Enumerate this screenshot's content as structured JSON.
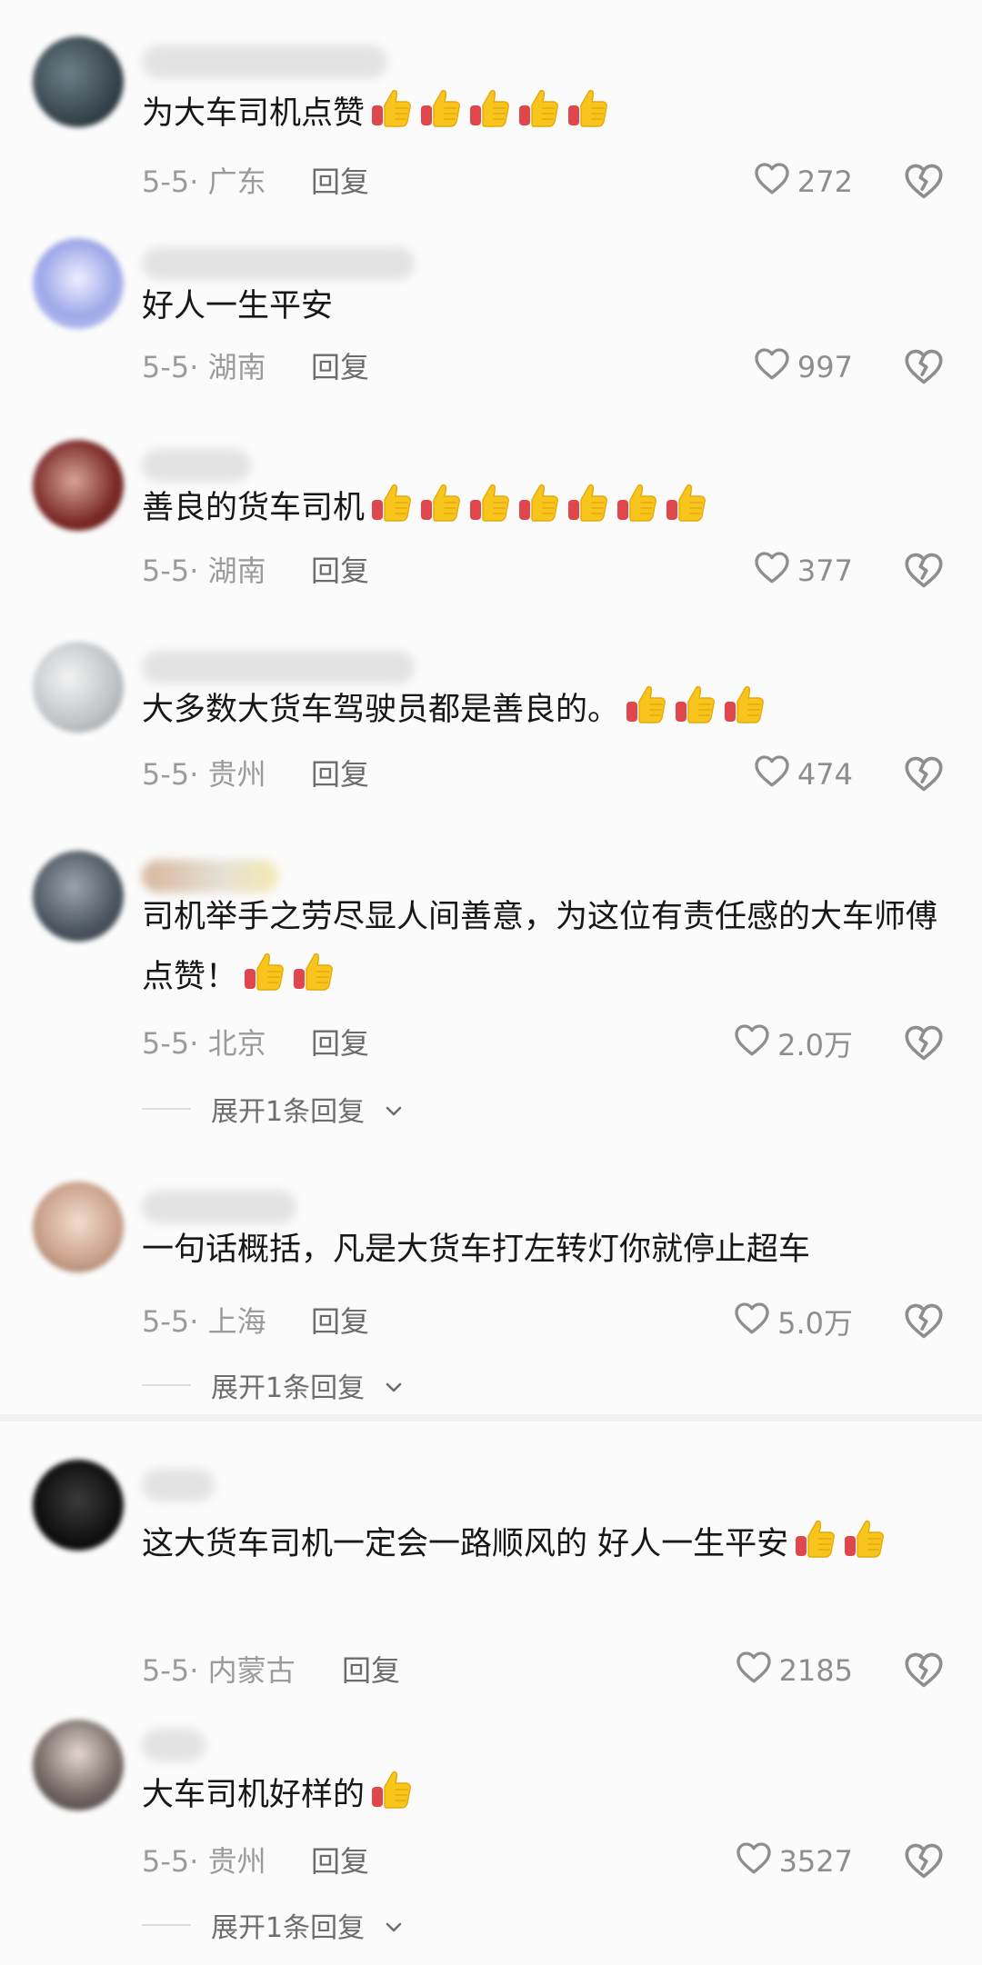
{
  "colors": {
    "text": "#171717",
    "meta": "#9b9b9b",
    "reply": "#6c6c6c",
    "icon": "#8e8e8e",
    "background": "#fbfbfb"
  },
  "icons": {
    "like": "heart-outline-icon",
    "dislike": "broken-heart-icon",
    "emoji": "thumbs-up-emoji",
    "expand": "chevron-down-icon"
  },
  "reply_label": "回复",
  "comments": [
    {
      "text": "为大车司机点赞",
      "emoji_count": 5,
      "date": "5-5",
      "location": "广东",
      "likes": "272",
      "replies": ""
    },
    {
      "text": "好人一生平安",
      "emoji_count": 0,
      "date": "5-5",
      "location": "湖南",
      "likes": "997",
      "replies": ""
    },
    {
      "text": "善良的货车司机",
      "emoji_count": 7,
      "date": "5-5",
      "location": "湖南",
      "likes": "377",
      "replies": ""
    },
    {
      "text": "大多数大货车驾驶员都是善良的。",
      "emoji_count": 3,
      "date": "5-5",
      "location": "贵州",
      "likes": "474",
      "replies": ""
    },
    {
      "text": "司机举手之劳尽显人间善意，为这位有责任感的大车师傅点赞！",
      "emoji_count": 2,
      "date": "5-5",
      "location": "北京",
      "likes": "2.0万",
      "replies": "展开1条回复"
    },
    {
      "text": "一句话概括，凡是大货车打左转灯你就停止超车",
      "emoji_count": 0,
      "date": "5-5",
      "location": "上海",
      "likes": "5.0万",
      "replies": "展开1条回复"
    },
    {
      "text": "这大货车司机一定会一路顺风的  好人一生平安",
      "emoji_count": 2,
      "date": "5-5",
      "location": "内蒙古",
      "likes": "2185",
      "replies": ""
    },
    {
      "text": "大车司机好样的",
      "emoji_count": 1,
      "date": "5-5",
      "location": "贵州",
      "likes": "3527",
      "replies": "展开1条回复"
    }
  ]
}
